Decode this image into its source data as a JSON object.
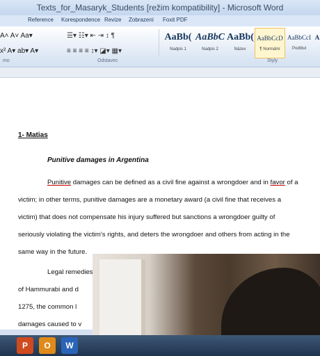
{
  "window": {
    "title": "Texts_for_Masaryk_Students [režim kompatibility] - Microsoft Word"
  },
  "tabs": [
    "Reference",
    "Korespondence",
    "Revize",
    "Zobrazení",
    "Foxit PDF"
  ],
  "ribbon": {
    "font_row1": "A˄ A˅  Aa▾  ",
    "font_row2": "x²  A▾  ab▾  A▾",
    "paragraph_label": "Odstavec",
    "styles_label": "Styly",
    "font_label_fragment": "mo",
    "styles": [
      {
        "sample": "AaBb(",
        "name": "Nadpis 1"
      },
      {
        "sample": "AaBbC",
        "name": "Nadpis 2"
      },
      {
        "sample": "AaBb(",
        "name": "Název"
      },
      {
        "sample": "AaBbCcD",
        "name": "¶ Normální"
      },
      {
        "sample": "AaBbCcI",
        "name": "Podtitul"
      },
      {
        "sample": "A",
        "name": ""
      }
    ]
  },
  "document": {
    "heading": "1- Matias",
    "subheading": "Punitive damages in Argentina",
    "para1": [
      {
        "pre": "",
        "u": "Punitive",
        "post": " damages can be defined as a civil fine against a wrongdoer and in "
      },
      {
        "text": "victim; in other terms, punitive damages are a monetary award (a civil fine that receives a"
      },
      {
        "text": "victim) that does not compensate his injury suffered but sanctions a wrongdoer guilty of"
      },
      {
        "text": "seriously violating the victim's rights, and deters the wrongdoer and others from acting in the"
      },
      {
        "text": "same way in the future."
      }
    ],
    "para1_favor": "favor",
    "para1_tail": " of a",
    "para2": [
      {
        "text": "Legal remedies"
      },
      {
        "text": "of Hammurabi and d"
      },
      {
        "text": "1275, the common l"
      },
      {
        "text": "damages caused to v"
      }
    ]
  },
  "taskbar": {
    "items": [
      "P",
      "O",
      "W"
    ]
  }
}
